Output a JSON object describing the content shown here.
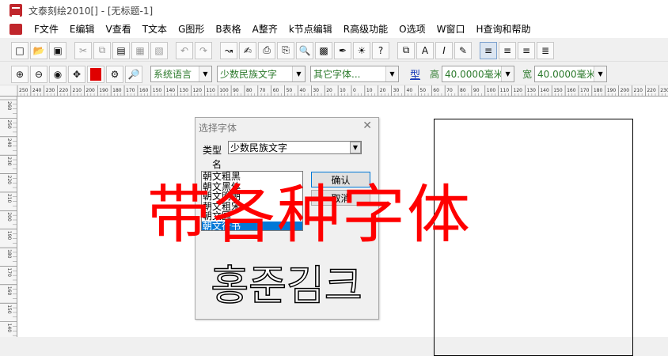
{
  "window": {
    "title": "文泰刻绘2010[] - [无标题-1]"
  },
  "menu": [
    "F文件",
    "E编辑",
    "V查看",
    "T文本",
    "G图形",
    "B表格",
    "A整齐",
    "k节点编辑",
    "R高级功能",
    "O选项",
    "W窗口",
    "H查询和帮助"
  ],
  "toolbar2": {
    "font_lang": "系统语言",
    "font_category": "少数民族文字",
    "font_name": "其它字体...",
    "type_button": "型",
    "height_label": "高",
    "height_value": "40.0000毫米",
    "width_label": "宽",
    "width_value": "40.0000毫米"
  },
  "ruler": {
    "h_ticks": [
      "250",
      "240",
      "230",
      "220",
      "210",
      "200",
      "190",
      "180",
      "170",
      "160",
      "150",
      "140",
      "130",
      "120",
      "110",
      "100",
      "90",
      "80",
      "70",
      "60",
      "50",
      "40",
      "30",
      "20",
      "10",
      "0",
      "10",
      "20",
      "30",
      "40",
      "50",
      "60",
      "70",
      "80",
      "90",
      "100",
      "110",
      "120",
      "130",
      "140",
      "150",
      "160",
      "170",
      "180",
      "190",
      "200",
      "210",
      "220",
      "230",
      "240"
    ],
    "v_ticks": [
      "260",
      "250",
      "240",
      "230",
      "220",
      "210",
      "200",
      "190",
      "180",
      "170",
      "160",
      "150",
      "140"
    ]
  },
  "dialog": {
    "title": "选择字体",
    "type_label": "类型",
    "type_value": "少数民族文字",
    "name_label": "名",
    "fonts": [
      "朝文粗黑",
      "朝文黑体",
      "朝文明朝",
      "朝文粗宋",
      "朝文圆",
      "朝文行书"
    ],
    "selected_index": 5,
    "ok_label": "确认",
    "cancel_label": "取消",
    "preview_text": "홍준김크"
  },
  "overlay": {
    "text": "带各种字体",
    "color": "#ff0000"
  }
}
